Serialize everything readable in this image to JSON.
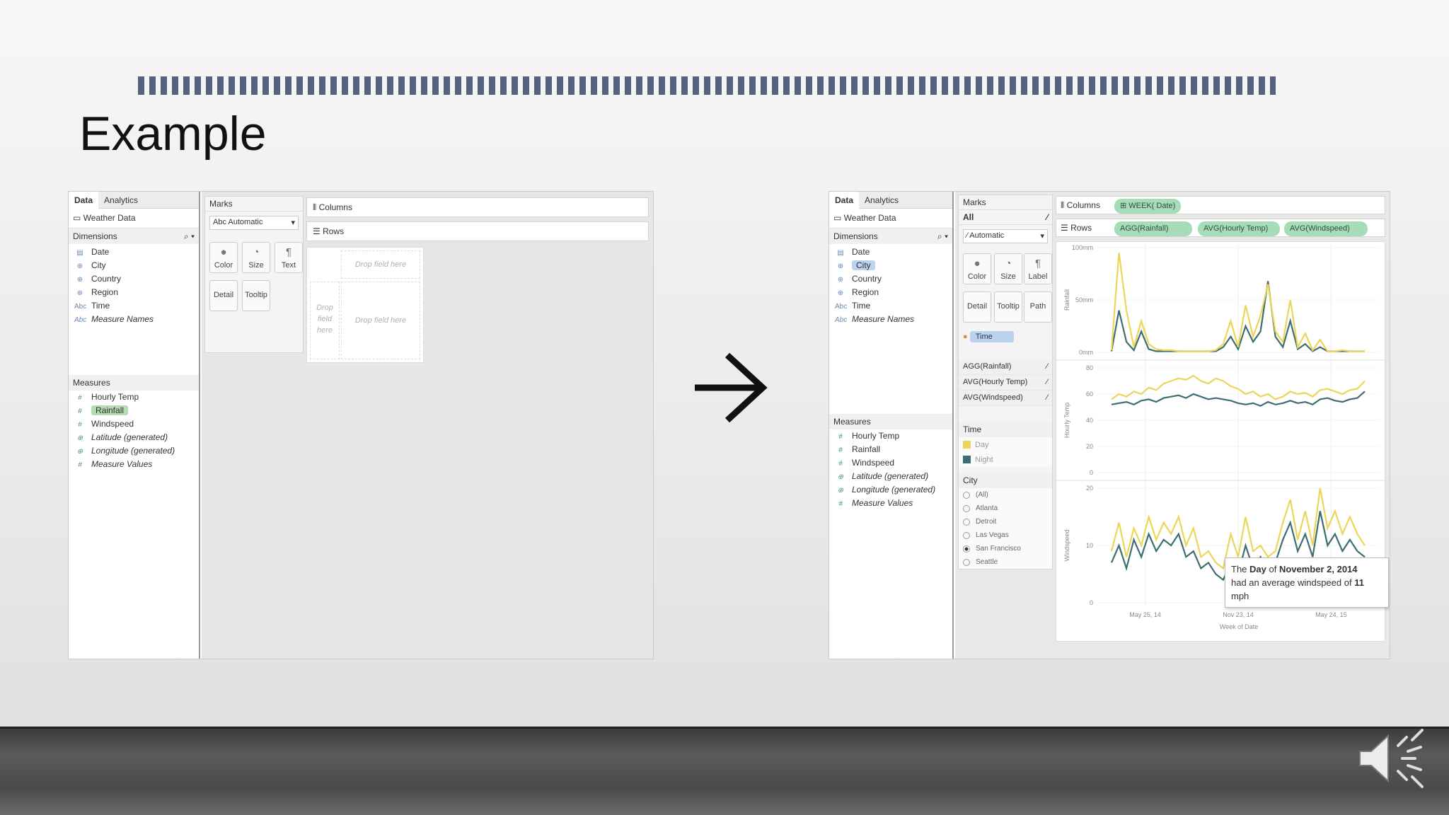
{
  "slide": {
    "title": "Example"
  },
  "left": {
    "tabs": [
      "Data",
      "Analytics"
    ],
    "datasource": "Weather Data",
    "dimensions_label": "Dimensions",
    "dimensions": [
      {
        "icon": "▤",
        "label": "Date"
      },
      {
        "icon": "⊕",
        "label": "City"
      },
      {
        "icon": "⊕",
        "label": "Country"
      },
      {
        "icon": "⊕",
        "label": "Region"
      },
      {
        "icon": "Abc",
        "label": "Time"
      },
      {
        "icon": "Abc",
        "label": "Measure Names"
      }
    ],
    "measures_label": "Measures",
    "measures": [
      {
        "icon": "#",
        "label": "Hourly Temp"
      },
      {
        "icon": "#",
        "label": "Rainfall"
      },
      {
        "icon": "#",
        "label": "Windspeed"
      },
      {
        "icon": "⊕",
        "label": "Latitude (generated)"
      },
      {
        "icon": "⊕",
        "label": "Longitude (generated)"
      },
      {
        "icon": "#",
        "label": "Measure Values"
      }
    ],
    "marks_label": "Marks",
    "mark_type": "Automatic",
    "mark_type_prefix": "Abc",
    "buttons": [
      "Color",
      "Size",
      "Text",
      "Detail",
      "Tooltip"
    ],
    "columns_label": "Columns",
    "rows_label": "Rows",
    "drop_field": "Drop field here",
    "drop_field_lines": [
      "Drop",
      "field",
      "here"
    ]
  },
  "right": {
    "tabs": [
      "Data",
      "Analytics"
    ],
    "datasource": "Weather Data",
    "dimensions_label": "Dimensions",
    "dimensions": [
      {
        "icon": "▤",
        "label": "Date"
      },
      {
        "icon": "⊕",
        "label": "City"
      },
      {
        "icon": "⊕",
        "label": "Country"
      },
      {
        "icon": "⊕",
        "label": "Region"
      },
      {
        "icon": "Abc",
        "label": "Time"
      },
      {
        "icon": "Abc",
        "label": "Measure Names"
      }
    ],
    "measures_label": "Measures",
    "measures": [
      {
        "icon": "#",
        "label": "Hourly Temp"
      },
      {
        "icon": "#",
        "label": "Rainfall"
      },
      {
        "icon": "#",
        "label": "Windspeed"
      },
      {
        "icon": "⊕",
        "label": "Latitude (generated)"
      },
      {
        "icon": "⊕",
        "label": "Longitude (generated)"
      },
      {
        "icon": "#",
        "label": "Measure Values"
      }
    ],
    "marks_label": "Marks",
    "marks_all": "All",
    "mark_type": "Automatic",
    "buttons": [
      "Color",
      "Size",
      "Label",
      "Detail",
      "Tooltip",
      "Path"
    ],
    "time_pill": "Time",
    "measure_pills": [
      "AGG(Rainfall)",
      "AVG(Hourly Temp)",
      "AVG(Windspeed)"
    ],
    "legend_title": "Time",
    "legend": [
      {
        "label": "Day",
        "color": "#ecd659"
      },
      {
        "label": "Night",
        "color": "#3c6e71"
      }
    ],
    "filter_title": "City",
    "filter_options": [
      "(All)",
      "Atlanta",
      "Detroit",
      "Las Vegas",
      "San Francisco",
      "Seattle"
    ],
    "filter_selected": "San Francisco",
    "columns_label": "Columns",
    "columns_pill": "WEEK( Date)",
    "rows_label": "Rows",
    "rows_pills": [
      "AGG(Rainfall)",
      "AVG(Hourly Temp)",
      "AVG(Windspeed)"
    ],
    "tooltip": {
      "l1a": "The ",
      "l1b": "Day",
      "l1c": " of ",
      "l1d": "November 2, 2014",
      "l2a": "had an average windspeed of ",
      "l2b": "11",
      "l2c": " mph"
    }
  },
  "chart_data": [
    {
      "type": "line",
      "title": "",
      "ylabel": "Rainfall",
      "yticks": [
        "0mm",
        "50mm",
        "100mm"
      ],
      "ylim": [
        0,
        100
      ],
      "x": [
        "May 25, 14",
        "Nov 23, 14",
        "May 24, 15"
      ],
      "series": [
        {
          "name": "Day",
          "values": [
            2,
            95,
            40,
            5,
            30,
            8,
            3,
            2,
            2,
            1,
            1,
            1,
            1,
            1,
            2,
            8,
            30,
            5,
            45,
            15,
            35,
            65,
            20,
            10,
            50,
            5,
            18,
            2,
            12,
            1,
            1,
            2,
            1,
            1,
            1
          ]
        },
        {
          "name": "Night",
          "values": [
            1,
            40,
            10,
            2,
            20,
            3,
            1,
            1,
            1,
            1,
            1,
            1,
            1,
            1,
            1,
            5,
            15,
            3,
            25,
            10,
            20,
            68,
            15,
            5,
            30,
            3,
            8,
            1,
            5,
            1,
            1,
            1,
            1,
            1,
            1
          ]
        }
      ]
    },
    {
      "type": "line",
      "title": "",
      "ylabel": "Hourly Temp",
      "yticks": [
        "0",
        "20",
        "40",
        "60",
        "80"
      ],
      "ylim": [
        0,
        80
      ],
      "x": [
        "May 25, 14",
        "Nov 23, 14",
        "May 24, 15"
      ],
      "series": [
        {
          "name": "Day",
          "values": [
            56,
            60,
            58,
            62,
            60,
            65,
            63,
            68,
            70,
            72,
            71,
            74,
            70,
            68,
            72,
            70,
            66,
            64,
            60,
            62,
            58,
            60,
            56,
            58,
            62,
            60,
            61,
            58,
            63,
            64,
            62,
            60,
            63,
            64,
            70
          ]
        },
        {
          "name": "Night",
          "values": [
            52,
            53,
            54,
            52,
            55,
            56,
            54,
            57,
            58,
            59,
            57,
            60,
            58,
            56,
            57,
            56,
            55,
            53,
            52,
            53,
            51,
            54,
            52,
            53,
            55,
            53,
            54,
            52,
            56,
            57,
            55,
            54,
            56,
            57,
            62
          ]
        }
      ]
    },
    {
      "type": "line",
      "title": "",
      "ylabel": "Windspeed",
      "xlabel": "Week of Date",
      "yticks": [
        "0",
        "10",
        "20"
      ],
      "ylim": [
        0,
        20
      ],
      "x": [
        "May 25, 14",
        "Nov 23, 14",
        "May 24, 15"
      ],
      "series": [
        {
          "name": "Day",
          "values": [
            9,
            14,
            8,
            13,
            10,
            15,
            11,
            14,
            12,
            15,
            10,
            13,
            8,
            9,
            7,
            6,
            12,
            8,
            15,
            9,
            10,
            8,
            9,
            14,
            18,
            11,
            16,
            10,
            20,
            13,
            16,
            12,
            15,
            12,
            10
          ]
        },
        {
          "name": "Night",
          "values": [
            7,
            10,
            6,
            11,
            8,
            12,
            9,
            11,
            10,
            12,
            8,
            9,
            6,
            7,
            5,
            4,
            7,
            5,
            10,
            6,
            8,
            5,
            7,
            11,
            14,
            9,
            12,
            8,
            16,
            10,
            12,
            9,
            11,
            9,
            8
          ]
        }
      ]
    }
  ]
}
